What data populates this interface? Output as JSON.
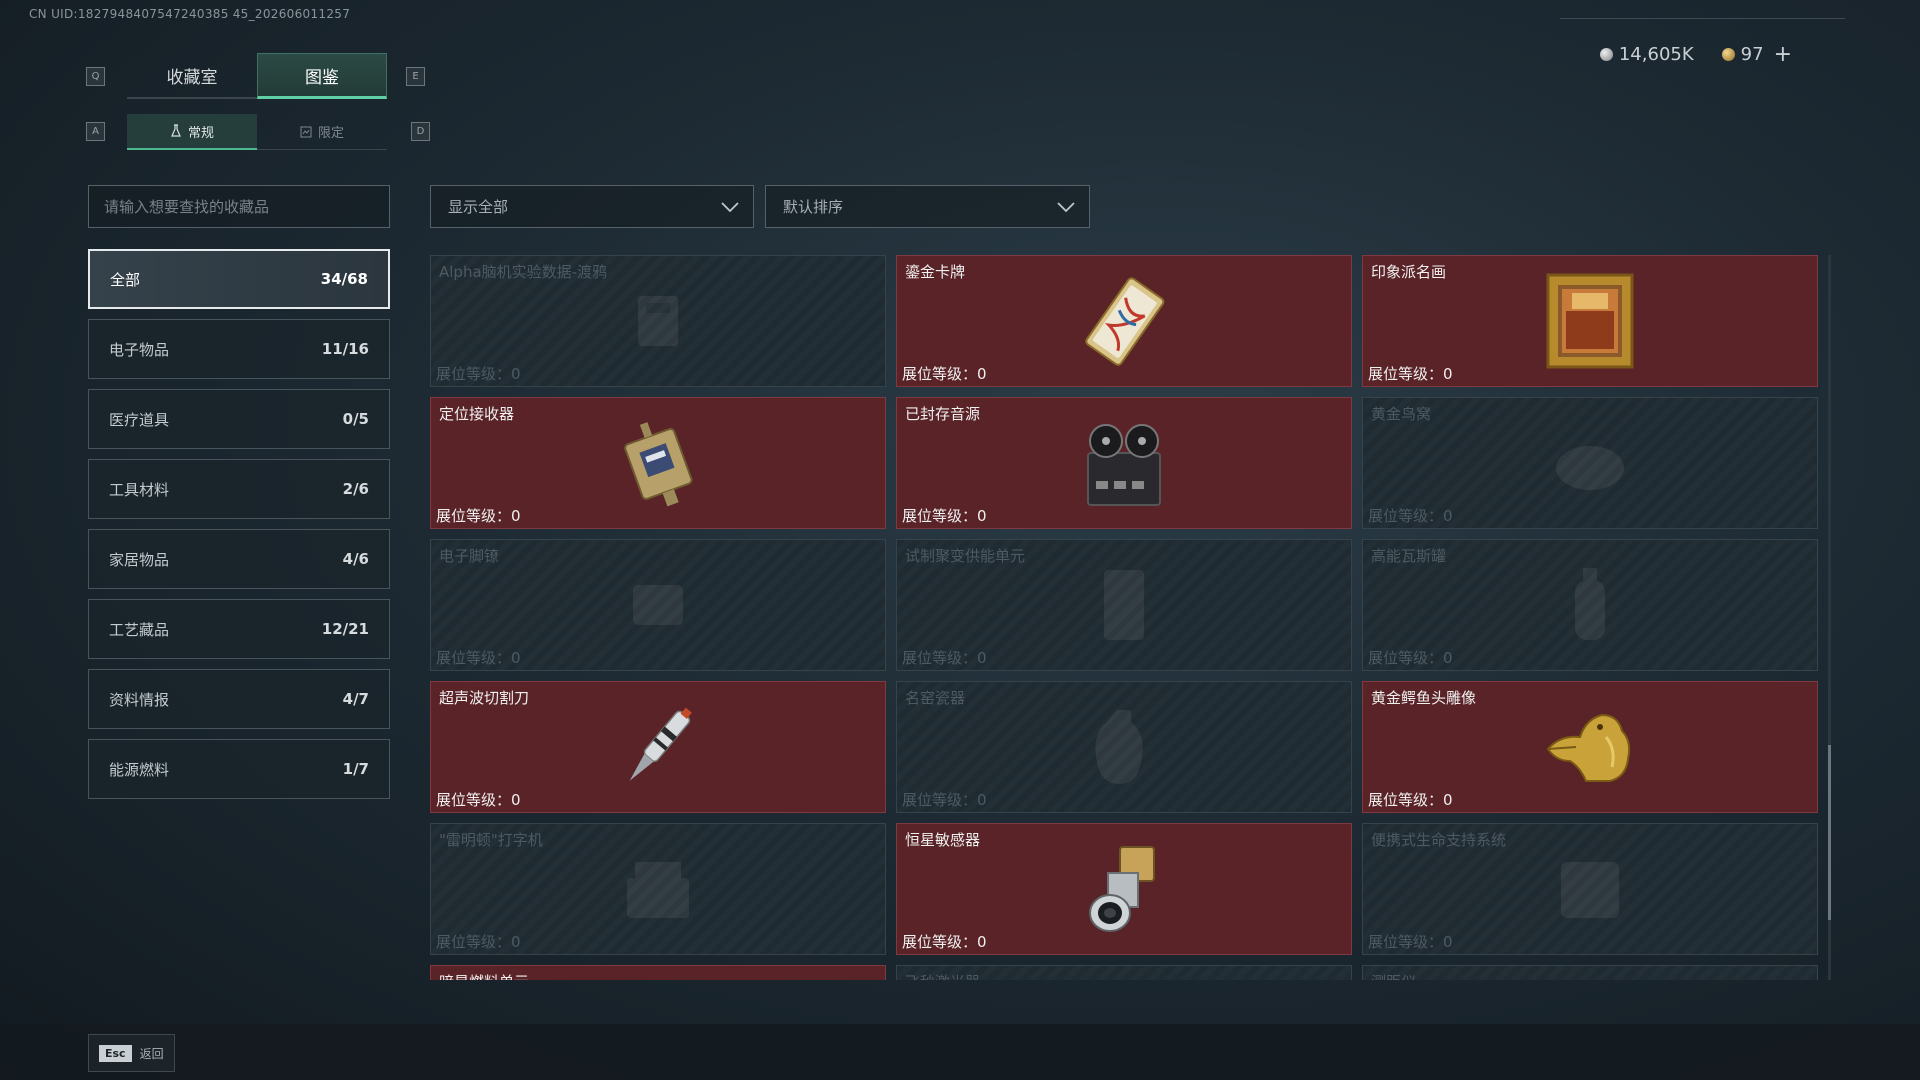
{
  "uid": "CN UID:1827948407547240385 45_202606011257",
  "currency": {
    "silver": "14,605K",
    "gold": "97",
    "plus": "+"
  },
  "keys": {
    "q": "Q",
    "e": "E",
    "a": "A",
    "d": "D"
  },
  "main_tabs": [
    "收藏室",
    "图鉴"
  ],
  "sub_tabs": [
    "常规",
    "限定"
  ],
  "search": {
    "placeholder": "请输入想要查找的收藏品"
  },
  "filters": {
    "show": "显示全部",
    "sort": "默认排序"
  },
  "categories": [
    {
      "label": "全部",
      "count": "34/68"
    },
    {
      "label": "电子物品",
      "count": "11/16"
    },
    {
      "label": "医疗道具",
      "count": "0/5"
    },
    {
      "label": "工具材料",
      "count": "2/6"
    },
    {
      "label": "家居物品",
      "count": "4/6"
    },
    {
      "label": "工艺藏品",
      "count": "12/21"
    },
    {
      "label": "资料情报",
      "count": "4/7"
    },
    {
      "label": "能源燃料",
      "count": "1/7"
    }
  ],
  "level_label": "展位等级：",
  "items": [
    {
      "name": "Alpha脑机实验数据-渡鸦",
      "level": "0",
      "owned": false,
      "icon": "data-drive-icon"
    },
    {
      "name": "鎏金卡牌",
      "level": "0",
      "owned": true,
      "icon": "gilded-card-icon"
    },
    {
      "name": "印象派名画",
      "level": "0",
      "owned": true,
      "icon": "painting-icon"
    },
    {
      "name": "定位接收器",
      "level": "0",
      "owned": true,
      "icon": "receiver-icon"
    },
    {
      "name": "已封存音源",
      "level": "0",
      "owned": true,
      "icon": "tape-recorder-icon"
    },
    {
      "name": "黄金鸟窝",
      "level": "0",
      "owned": false,
      "icon": "golden-nest-icon"
    },
    {
      "name": "电子脚镣",
      "level": "0",
      "owned": false,
      "icon": "ankle-monitor-icon"
    },
    {
      "name": "试制聚变供能单元",
      "level": "0",
      "owned": false,
      "icon": "fusion-cell-icon"
    },
    {
      "name": "高能瓦斯罐",
      "level": "0",
      "owned": false,
      "icon": "gas-canister-icon"
    },
    {
      "name": "超声波切割刀",
      "level": "0",
      "owned": true,
      "icon": "ultrasonic-knife-icon"
    },
    {
      "name": "名窑瓷器",
      "level": "0",
      "owned": false,
      "icon": "porcelain-vase-icon"
    },
    {
      "name": "黄金鳄鱼头雕像",
      "level": "0",
      "owned": true,
      "icon": "gold-crocodile-icon"
    },
    {
      "name": "\"雷明顿\"打字机",
      "level": "0",
      "owned": false,
      "icon": "typewriter-icon"
    },
    {
      "name": "恒星敏感器",
      "level": "0",
      "owned": true,
      "icon": "star-sensor-icon"
    },
    {
      "name": "便携式生命支持系统",
      "level": "0",
      "owned": false,
      "icon": "life-support-icon"
    }
  ],
  "partial_items": [
    {
      "name": "暗星燃料单元",
      "owned": true
    },
    {
      "name": "飞秒激光器",
      "owned": false
    },
    {
      "name": "测距仪",
      "owned": false
    }
  ],
  "footer": {
    "key": "Esc",
    "label": "返回"
  }
}
